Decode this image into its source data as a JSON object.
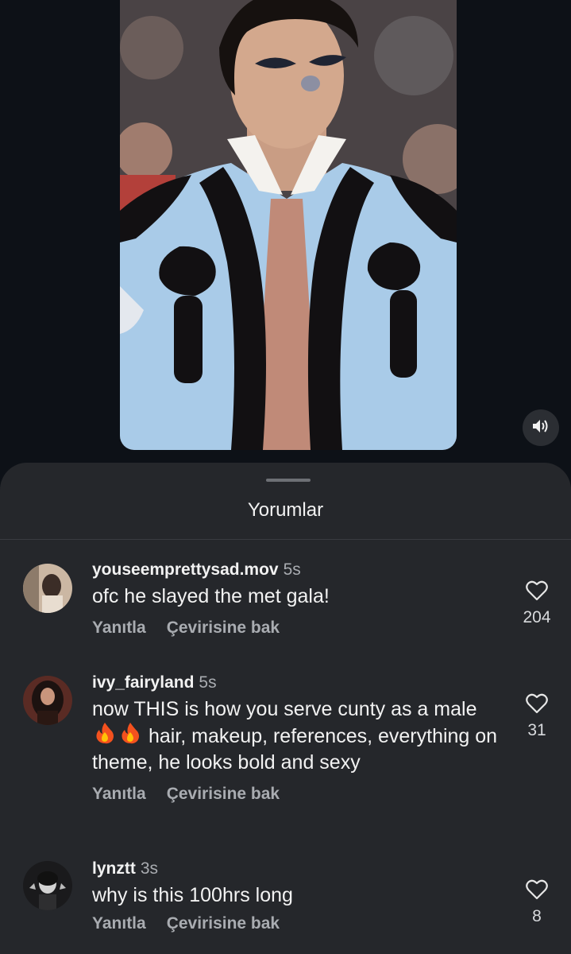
{
  "sheet": {
    "title": "Yorumlar"
  },
  "comments": [
    {
      "username": "youseemprettysad.mov",
      "time": "5s",
      "text": "ofc he slayed the met gala!",
      "reply_label": "Yanıtla",
      "translate_label": "Çevirisine bak",
      "likes": "204"
    },
    {
      "username": "ivy_fairyland",
      "time": "5s",
      "text_part1": "now THIS is how you serve cunty as a male",
      "text_part2": "hair, makeup, references, everything on theme, he looks bold and sexy",
      "reply_label": "Yanıtla",
      "translate_label": "Çevirisine bak",
      "likes": "31"
    },
    {
      "username": "lynztt",
      "time": "3s",
      "text": "why is this 100hrs long",
      "reply_label": "Yanıtla",
      "translate_label": "Çevirisine bak",
      "likes": "8"
    }
  ],
  "icons": {
    "sound": "speaker-icon",
    "like": "heart-icon",
    "emoji": "fire-icon"
  },
  "colors": {
    "background": "#0d1117",
    "sheet": "#25272b",
    "secondary_text": "#a9acb1",
    "jacket": "#a9cbe8"
  }
}
